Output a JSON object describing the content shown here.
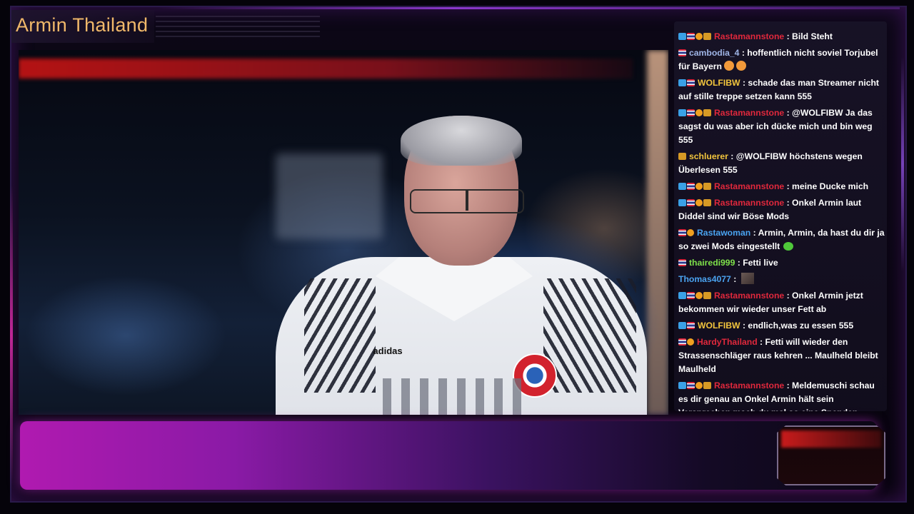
{
  "channel": {
    "title": "Armin Thailand"
  },
  "colors": {
    "title": "#f0b86a",
    "chat_text": "#ffffff",
    "bottom_bar_start": "#b01ab0",
    "bottom_bar_end": "#0c0716"
  },
  "chat": {
    "messages": [
      {
        "user": "Rastamannstone",
        "user_color": "#e0283c",
        "badges": [
          "prime",
          "flag",
          "sub",
          "vip"
        ],
        "text": "Bild Steht",
        "emote": ""
      },
      {
        "user": "cambodia_4",
        "user_color": "#9fb5e6",
        "badges": [
          "flag"
        ],
        "text": "hoffentlich nicht soviel Torjubel für Bayern",
        "emote": "hug"
      },
      {
        "user": "WOLFIBW",
        "user_color": "#f2c53d",
        "badges": [
          "prime",
          "flag"
        ],
        "text": "schade das man Streamer nicht auf stille treppe setzen kann 555",
        "emote": ""
      },
      {
        "user": "Rastamannstone",
        "user_color": "#e0283c",
        "badges": [
          "prime",
          "flag",
          "sub",
          "vip"
        ],
        "text": "@WOLFIBW Ja das sagst du was aber ich dücke mich und bin weg 555",
        "emote": ""
      },
      {
        "user": "schluerer",
        "user_color": "#f2c53d",
        "badges": [
          "vip"
        ],
        "text": "@WOLFIBW höchstens wegen Überlesen 555",
        "emote": ""
      },
      {
        "user": "Rastamannstone",
        "user_color": "#e0283c",
        "badges": [
          "prime",
          "flag",
          "sub",
          "vip"
        ],
        "text": "meine Ducke mich",
        "emote": ""
      },
      {
        "user": "Rastamannstone",
        "user_color": "#e0283c",
        "badges": [
          "prime",
          "flag",
          "sub",
          "vip"
        ],
        "text": "Onkel Armin laut Diddel sind wir Böse Mods",
        "emote": ""
      },
      {
        "user": "Rastawoman",
        "user_color": "#4aa3f0",
        "badges": [
          "flag",
          "sub"
        ],
        "text": "Armin, Armin, da hast du dir ja so zwei Mods eingestellt",
        "emote": "green"
      },
      {
        "user": "thairedi999",
        "user_color": "#7ee04a",
        "badges": [
          "flag"
        ],
        "text": "Fetti live",
        "emote": ""
      },
      {
        "user": "Thomas4077",
        "user_color": "#4aa3f0",
        "badges": [],
        "text": "",
        "emote": "img"
      },
      {
        "user": "Rastamannstone",
        "user_color": "#e0283c",
        "badges": [
          "prime",
          "flag",
          "sub",
          "vip"
        ],
        "text": "Onkel Armin jetzt bekommen wir wieder unser Fett ab",
        "emote": ""
      },
      {
        "user": "WOLFIBW",
        "user_color": "#f2c53d",
        "badges": [
          "prime",
          "flag"
        ],
        "text": "endlich,was zu essen 555",
        "emote": ""
      },
      {
        "user": "HardyThailand",
        "user_color": "#e0283c",
        "badges": [
          "flag",
          "sub"
        ],
        "text": "Fetti will wieder den Strassenschläger raus kehren ... Maulheld bleibt Maulheld",
        "emote": ""
      },
      {
        "user": "Rastamannstone",
        "user_color": "#e0283c",
        "badges": [
          "prime",
          "flag",
          "sub",
          "vip"
        ],
        "text": "Meldemuschi schau es dir genau an Onkel Armin hält sein Versprechen mach du mal so eine Spenden Aktion du Lusche",
        "emote": ""
      }
    ]
  },
  "video": {
    "shirt_brand": "adidas"
  }
}
